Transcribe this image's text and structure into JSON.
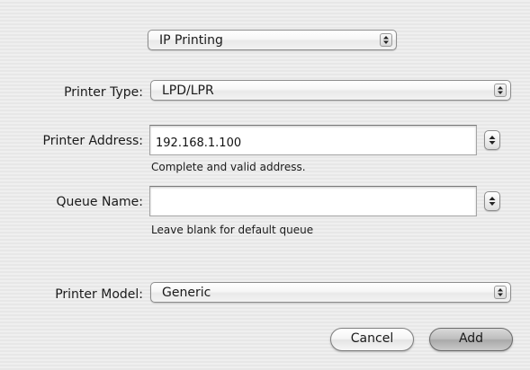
{
  "protocol_popup": {
    "value": "IP Printing"
  },
  "printer_type": {
    "label": "Printer Type:",
    "value": "LPD/LPR"
  },
  "printer_address": {
    "label": "Printer Address:",
    "value": "192.168.1.100",
    "hint": "Complete and valid address."
  },
  "queue_name": {
    "label": "Queue Name:",
    "value": "",
    "hint": "Leave blank for default queue"
  },
  "printer_model": {
    "label": "Printer Model:",
    "value": "Generic"
  },
  "buttons": {
    "cancel": "Cancel",
    "add": "Add"
  },
  "icons": {
    "popup_arrows": "up-down-arrows-icon",
    "stepper": "up-down-arrows-icon"
  }
}
